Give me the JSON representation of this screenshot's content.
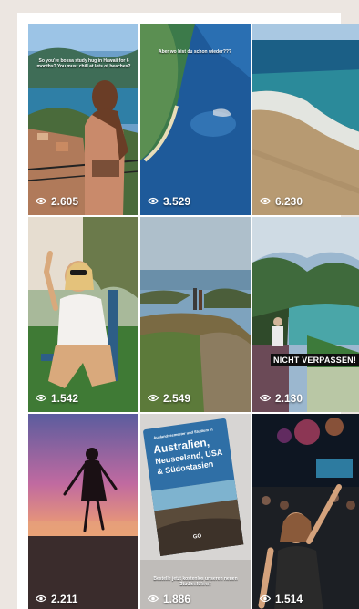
{
  "posts": [
    {
      "views": "2.605",
      "caption": "So you're bossa study hug in Hawaii for 6 months? You must chill at lots of beaches?"
    },
    {
      "views": "3.529",
      "caption": "Aber wo bist du schon wieder???"
    },
    {
      "views": "6.230"
    },
    {
      "views": "1.542"
    },
    {
      "views": "2.549"
    },
    {
      "views": "2.130",
      "badge": "NICHT VERPASSEN!"
    },
    {
      "views": "2.211"
    },
    {
      "views": "1.886",
      "book_heading": "Auslandssemester und Studium in",
      "book_title_1": "Australien,",
      "book_title_2": "Neuseeland, USA",
      "book_title_3": "& Südostasien",
      "book_footer": "GO",
      "caption": "Bestelle jetzt kostenlos unseren neuen Studienführer!"
    },
    {
      "views": "1.514"
    }
  ],
  "icons": {
    "views": "eye-icon"
  }
}
